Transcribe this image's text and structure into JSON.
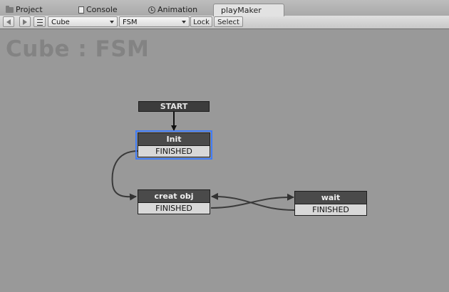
{
  "tabs": [
    {
      "label": "Project",
      "icon": "folder-icon"
    },
    {
      "label": "Console",
      "icon": "console-icon"
    },
    {
      "label": "Animation",
      "icon": "clock-icon"
    },
    {
      "label": "playMaker",
      "active": true
    }
  ],
  "toolbar": {
    "object_value": "Cube",
    "fsm_value": "FSM",
    "lock_label": "Lock",
    "select_label": "Select"
  },
  "canvas": {
    "title": "Cube : FSM",
    "start_label": "START",
    "states": [
      {
        "name": "Init",
        "event": "FINISHED",
        "selected": true
      },
      {
        "name": "creat obj",
        "event": "FINISHED"
      },
      {
        "name": "wait",
        "event": "FINISHED"
      }
    ]
  },
  "colors": {
    "canvas_bg": "#999999",
    "selection_outline": "#3f7bf6",
    "state_header": "#4a4a4a",
    "link_line": "#3a3a3a"
  }
}
